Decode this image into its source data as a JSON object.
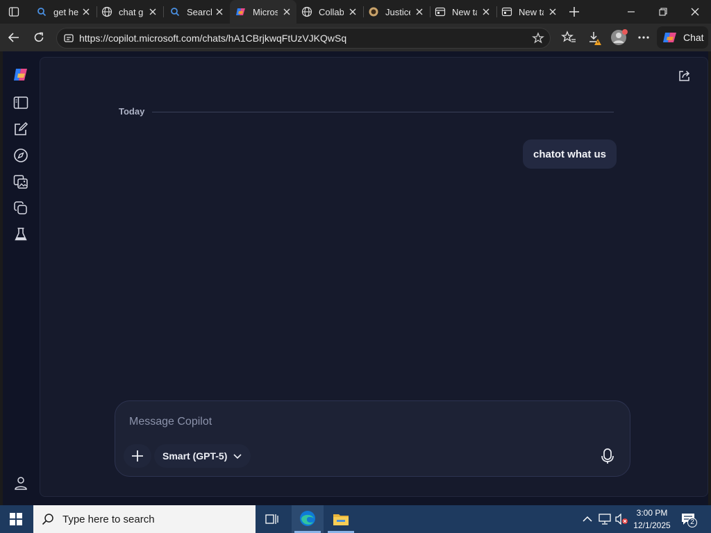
{
  "browser": {
    "tabs": [
      {
        "title": "get he",
        "favicon": "search-icon"
      },
      {
        "title": "chat g",
        "favicon": "globe-icon"
      },
      {
        "title": "Search",
        "favicon": "search-icon"
      },
      {
        "title": "Micros",
        "favicon": "copilot-logo-icon",
        "active": true
      },
      {
        "title": "Collab",
        "favicon": "globe-icon"
      },
      {
        "title": "Justice",
        "favicon": "site-icon"
      },
      {
        "title": "New ta",
        "favicon": "newtab-icon"
      },
      {
        "title": "New ta",
        "favicon": "newtab-icon"
      }
    ],
    "url": "https://copilot.microsoft.com/chats/hA1CBrjkwqFtUzVJKQwSq",
    "chat_button_label": "Chat"
  },
  "chat": {
    "date_divider": "Today",
    "messages": [
      {
        "role": "user",
        "text": "chatot what us"
      }
    ]
  },
  "composer": {
    "placeholder": "Message Copilot",
    "model_label": "Smart (GPT-5)"
  },
  "taskbar": {
    "search_placeholder": "Type here to search",
    "time": "3:00 PM",
    "date": "12/1/2025",
    "notification_count": "2"
  },
  "colors": {
    "page_bg": "#101426",
    "panel_bg": "#161a2c",
    "bubble_bg": "#232941",
    "taskbar_bg": "#1e3a5f"
  }
}
